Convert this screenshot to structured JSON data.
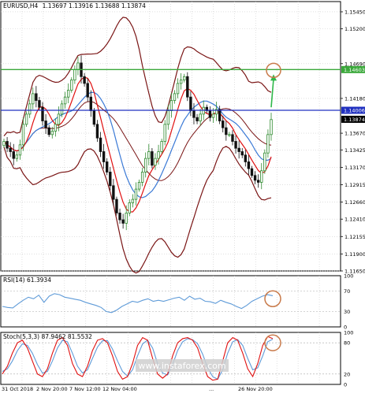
{
  "symbol_header": {
    "symbol": "EURUSD,H4",
    "ohlc": "1.13697 1.13916 1.13688 1.13874"
  },
  "rsi_label": "RSI(14) 61.3934",
  "stoch_label": "Stoch(5,3,3) 87.9462 81.5532",
  "watermark": "www.instaforex.com",
  "colors": {
    "up_candle": "#2f8a2f",
    "down_candle": "#111111",
    "bollinger": "#7a1515",
    "ma_fast": "#e01010",
    "ma_slow": "#3b7ad6",
    "resistance": "#3aa83a",
    "pivot": "#2030c0",
    "rsi_line": "#5f9bd8",
    "stoch_main": "#e01010",
    "stoch_signal": "#5f9bd8",
    "annotation_circle": "#c87a4a",
    "arrow": "#2fb84a"
  },
  "chart_data": [
    {
      "type": "candlestick",
      "name": "main",
      "y_ticks": [
        "1.15450",
        "1.15200",
        "1.14690",
        "1.14180",
        "1.13670",
        "1.13425",
        "1.13170",
        "1.12915",
        "1.12660",
        "1.12410",
        "1.12155",
        "1.11900",
        "1.11650"
      ],
      "x_ticks": [
        "31 Oct 2018",
        "2 Nov 20:00",
        "7 Nov 12:00",
        "12 Nov 04:00",
        "...",
        "26 Nov 20:00"
      ],
      "ylim": [
        1.1165,
        1.156
      ],
      "price_labels": [
        {
          "text": "1.14603",
          "value": 1.14603,
          "bg": "#3aa83a"
        },
        {
          "text": "1.14006",
          "value": 1.14006,
          "bg": "#2030c0"
        },
        {
          "text": "1.13870",
          "value": 1.1387,
          "bg": "#ffffff"
        },
        {
          "text": "1.13874",
          "value": 1.13874,
          "bg": "#000000"
        }
      ],
      "horizontal_levels": [
        {
          "value": 1.14603,
          "role": "resistance"
        },
        {
          "value": 1.14006,
          "role": "pivot"
        }
      ],
      "target": 1.1458,
      "close": [
        1.1355,
        1.1345,
        1.134,
        1.133,
        1.1335,
        1.135,
        1.138,
        1.1395,
        1.141,
        1.1425,
        1.1415,
        1.1405,
        1.1385,
        1.1375,
        1.1365,
        1.137,
        1.138,
        1.1395,
        1.141,
        1.142,
        1.143,
        1.1445,
        1.146,
        1.147,
        1.145,
        1.144,
        1.142,
        1.14,
        1.138,
        1.136,
        1.134,
        1.1325,
        1.131,
        1.129,
        1.127,
        1.125,
        1.124,
        1.1235,
        1.125,
        1.1265,
        1.127,
        1.1285,
        1.1295,
        1.131,
        1.133,
        1.134,
        1.132,
        1.133,
        1.134,
        1.1355,
        1.138,
        1.14,
        1.1415,
        1.1425,
        1.144,
        1.1445,
        1.145,
        1.142,
        1.14,
        1.139,
        1.1385,
        1.1395,
        1.1405,
        1.14,
        1.139,
        1.1395,
        1.1402,
        1.1385,
        1.1375,
        1.1365,
        1.1365,
        1.1355,
        1.1345,
        1.134,
        1.1335,
        1.1325,
        1.1315,
        1.1305,
        1.1298,
        1.1295,
        1.1312,
        1.1338,
        1.1365,
        1.1387
      ]
    },
    {
      "type": "line",
      "name": "RSI",
      "ylim": [
        0,
        100
      ],
      "levels": [
        70,
        30
      ],
      "values": [
        40,
        38,
        37,
        45,
        52,
        58,
        55,
        62,
        48,
        60,
        65,
        63,
        58,
        56,
        54,
        52,
        48,
        45,
        42,
        38,
        30,
        28,
        33,
        40,
        45,
        50,
        48,
        52,
        55,
        50,
        52,
        50,
        53,
        56,
        58,
        52,
        60,
        54,
        56,
        50,
        49,
        46,
        52,
        48,
        45,
        40,
        36,
        42,
        50,
        55,
        60,
        63,
        61
      ]
    },
    {
      "type": "line",
      "name": "Stochastic",
      "ylim": [
        0,
        100
      ],
      "levels": [
        80,
        20
      ],
      "main": [
        20,
        35,
        60,
        80,
        85,
        70,
        45,
        20,
        15,
        30,
        60,
        85,
        90,
        75,
        40,
        20,
        15,
        35,
        65,
        85,
        88,
        80,
        55,
        25,
        10,
        15,
        40,
        75,
        90,
        85,
        50,
        20,
        12,
        20,
        55,
        80,
        88,
        90,
        85,
        70,
        40,
        15,
        8,
        10,
        45,
        80,
        90,
        85,
        60,
        30,
        15,
        40,
        75,
        92,
        88
      ],
      "signal": [
        25,
        30,
        45,
        65,
        78,
        75,
        60,
        38,
        22,
        25,
        45,
        70,
        85,
        82,
        60,
        35,
        22,
        28,
        50,
        72,
        84,
        84,
        68,
        45,
        25,
        16,
        28,
        55,
        78,
        85,
        70,
        40,
        22,
        18,
        38,
        65,
        82,
        88,
        86,
        78,
        58,
        32,
        15,
        10,
        28,
        60,
        82,
        86,
        75,
        50,
        28,
        32,
        55,
        82,
        87
      ]
    }
  ]
}
